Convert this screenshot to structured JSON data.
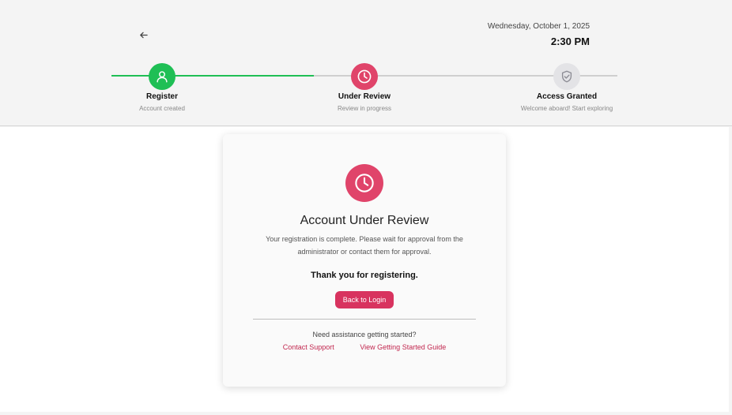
{
  "header": {
    "date": "Wednesday, October 1, 2025",
    "time": "2:30 PM"
  },
  "steps": [
    {
      "title": "Register",
      "subtitle": "Account created",
      "icon": "user-icon",
      "status": "complete",
      "color": "#1fbf55"
    },
    {
      "title": "Under Review",
      "subtitle": "Review in progress",
      "icon": "clock-icon",
      "status": "current",
      "color": "#e0446a"
    },
    {
      "title": "Access Granted",
      "subtitle": "Welcome aboard! Start exploring",
      "icon": "shield-check-icon",
      "status": "pending",
      "color": "#e3e3e6"
    }
  ],
  "card": {
    "icon": "clock-icon",
    "title": "Account Under Review",
    "message": "Your registration is complete. Please wait for approval from the administrator or contact them for approval.",
    "thanks": "Thank you for registering.",
    "button_label": "Back to Login",
    "assist_text": "Need assistance getting started?",
    "links": [
      "Contact Support",
      "View Getting Started Guide"
    ]
  },
  "colors": {
    "success": "#1fbf55",
    "accent": "#e0446a",
    "button": "#d8335f",
    "link": "#c2274f"
  }
}
